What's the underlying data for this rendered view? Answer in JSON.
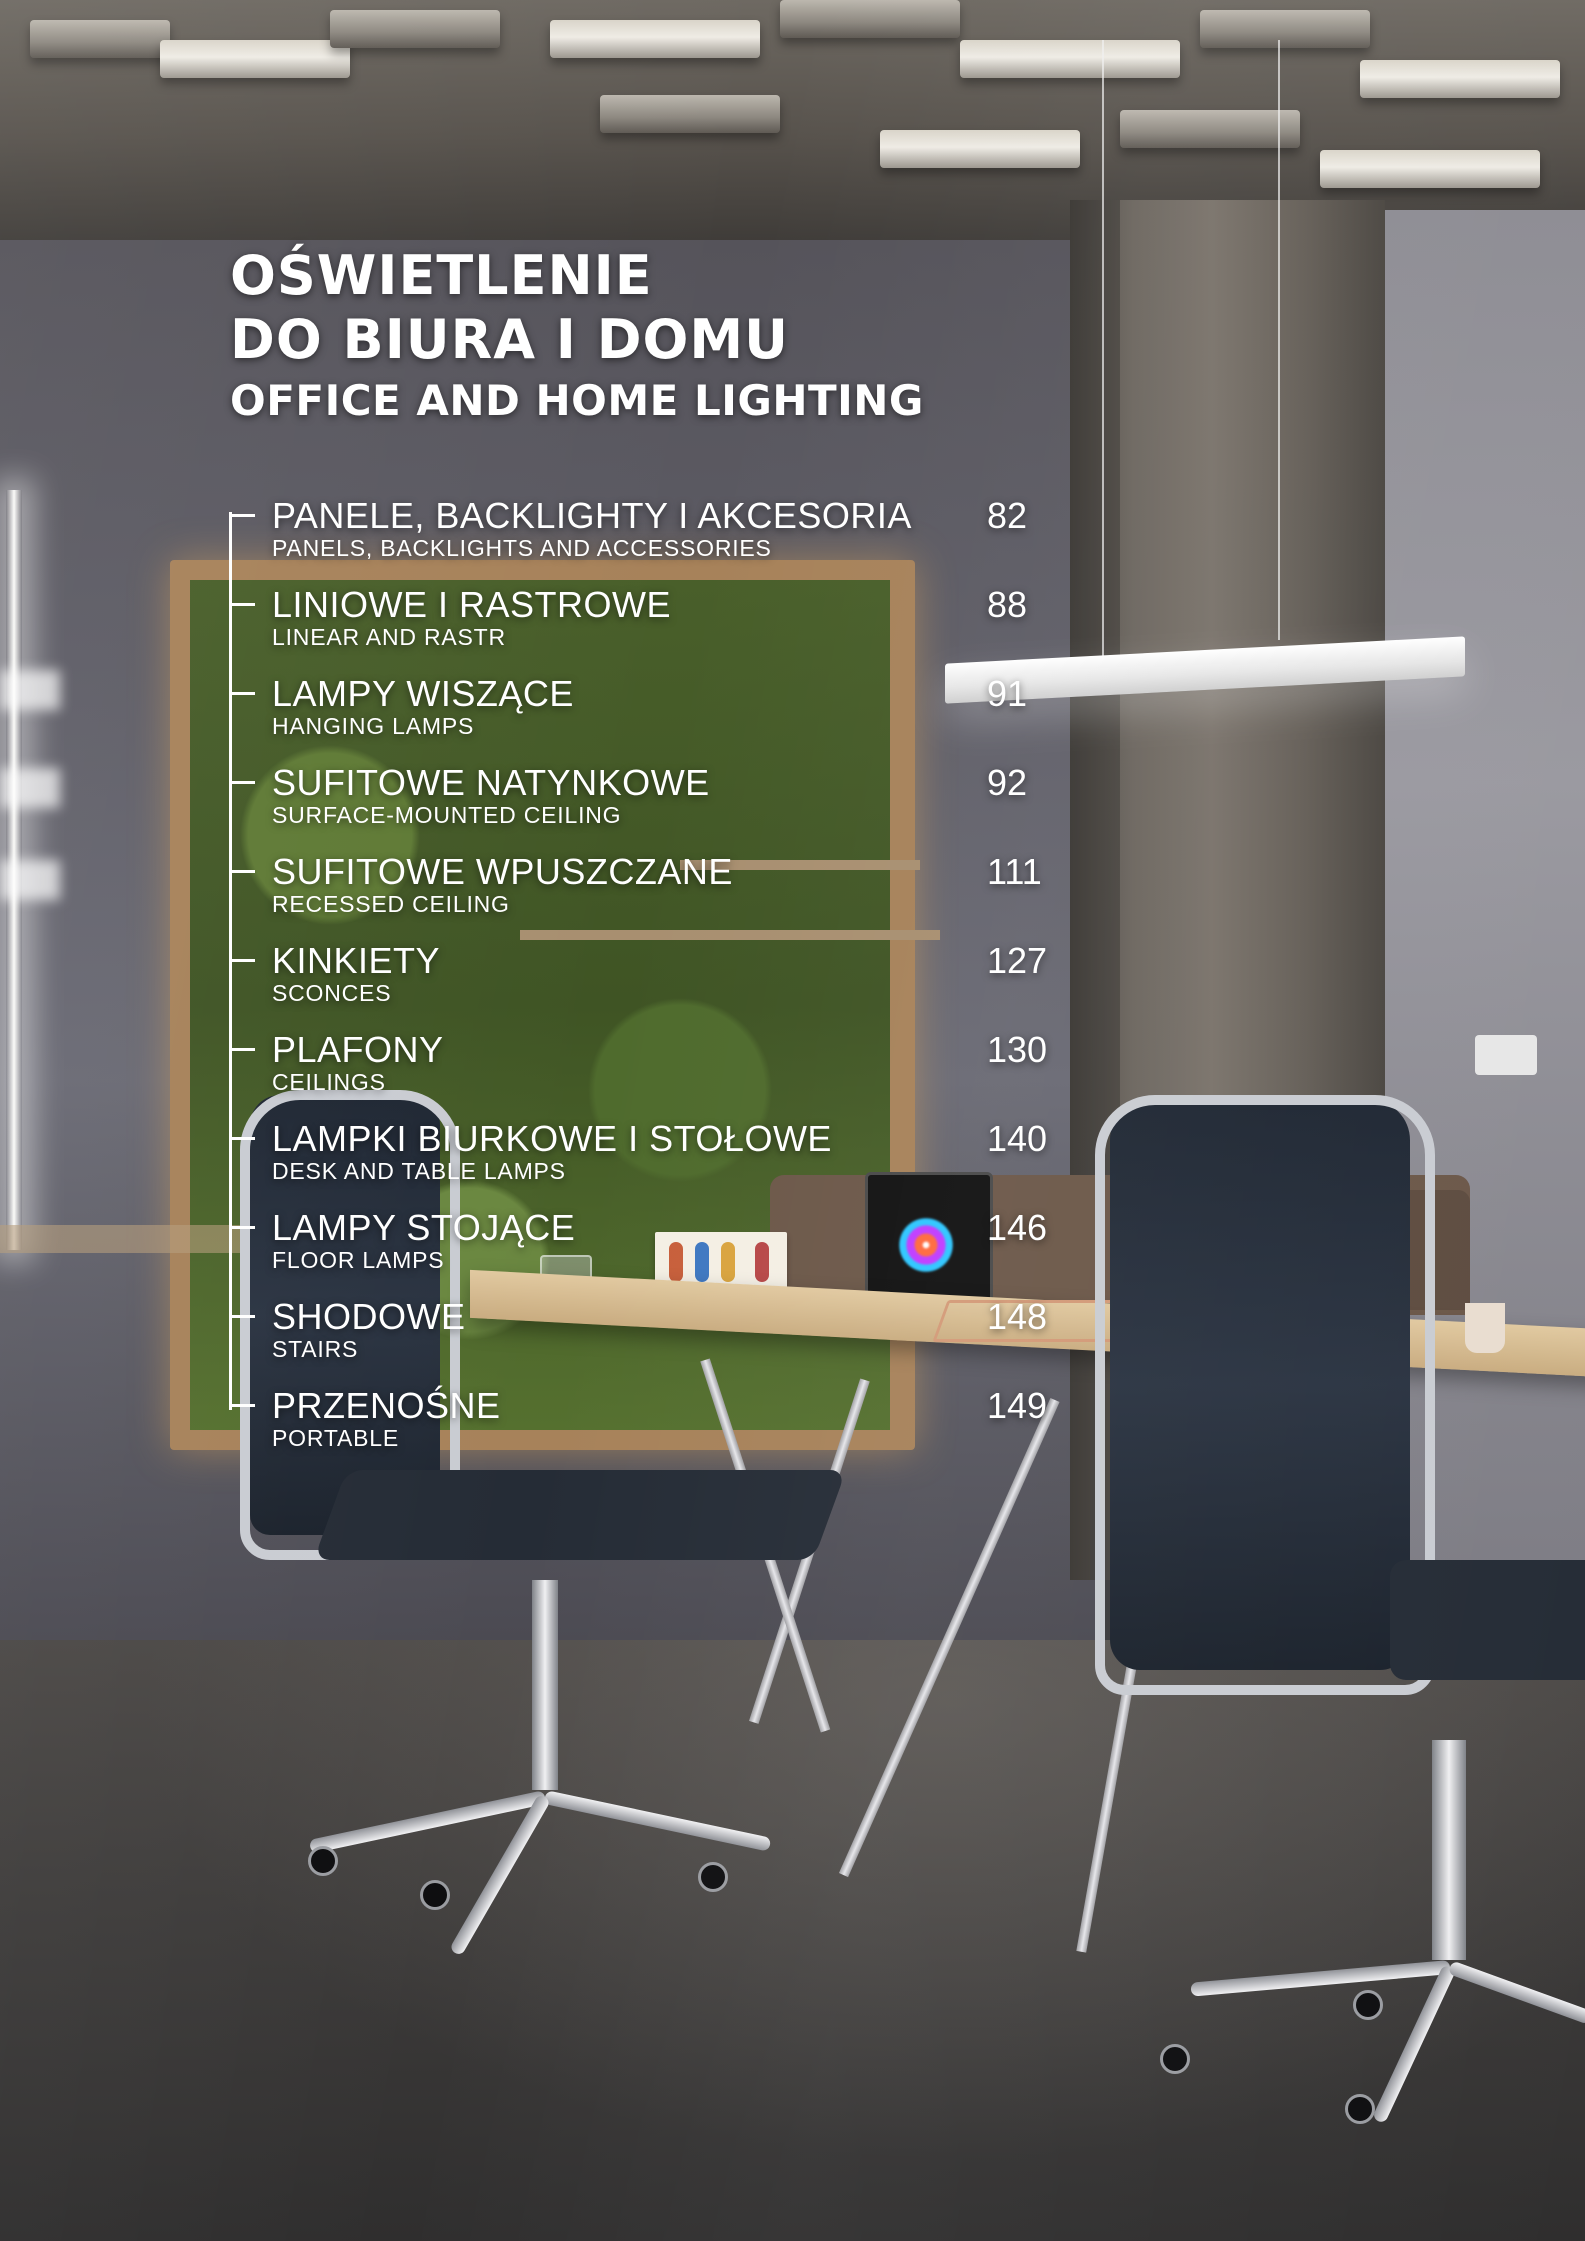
{
  "title": {
    "line1": "OŚWIETLENIE",
    "line2": "DO BIURA I DOMU",
    "subtitle": "OFFICE AND HOME LIGHTING"
  },
  "toc": [
    {
      "pl": "PANELE, BACKLIGHTY I AKCESORIA",
      "en": "PANELS, BACKLIGHTS AND ACCESSORIES",
      "page": "82"
    },
    {
      "pl": "LINIOWE I RASTROWE",
      "en": "LINEAR AND RASTR",
      "page": "88"
    },
    {
      "pl": "LAMPY WISZĄCE",
      "en": "HANGING LAMPS",
      "page": "91"
    },
    {
      "pl": "SUFITOWE NATYNKOWE",
      "en": "SURFACE-MOUNTED CEILING",
      "page": "92"
    },
    {
      "pl": "SUFITOWE WPUSZCZANE",
      "en": "RECESSED CEILING",
      "page": "111"
    },
    {
      "pl": "KINKIETY",
      "en": "SCONCES",
      "page": "127"
    },
    {
      "pl": "PLAFONY",
      "en": "CEILINGS",
      "page": "130"
    },
    {
      "pl": "LAMPKI BIURKOWE I STOŁOWE",
      "en": "DESK AND TABLE LAMPS",
      "page": "140"
    },
    {
      "pl": "LAMPY STOJĄCE",
      "en": "FLOOR LAMPS",
      "page": "146"
    },
    {
      "pl": "SHODOWE",
      "en": "STAIRS",
      "page": "148"
    },
    {
      "pl": "PRZENOŚNE",
      "en": "PORTABLE",
      "page": "149"
    }
  ],
  "colors": {
    "text": "#ffffff",
    "ceiling": "#6e6962",
    "wall": "#5e5d66",
    "moss": "#495f2a",
    "desk": "#e1c9a0",
    "chair": "#1f2733",
    "floor": "#3f3d3c"
  }
}
